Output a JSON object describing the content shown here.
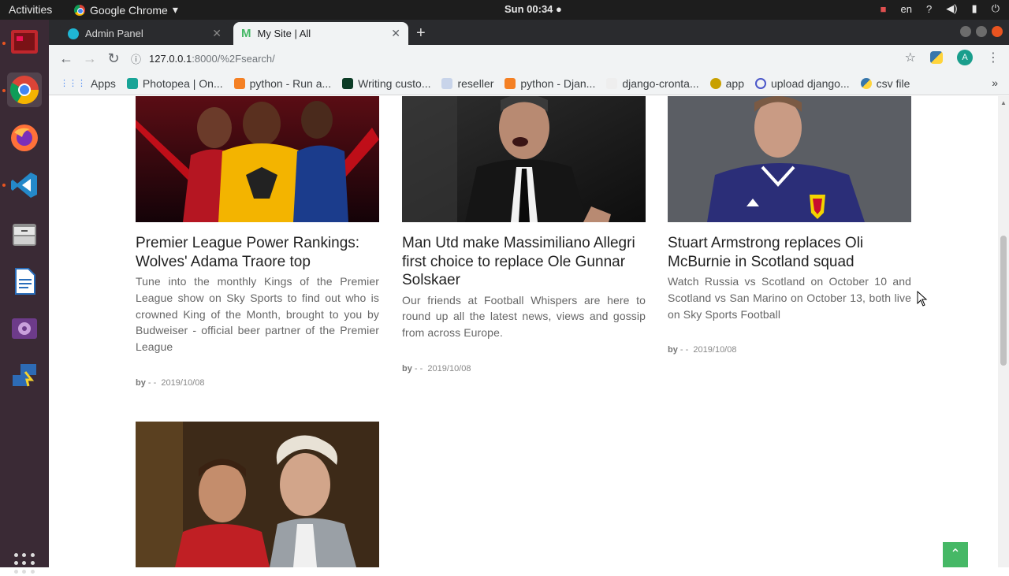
{
  "system": {
    "activities": "Activities",
    "app_name": "Google Chrome",
    "clock": "Sun 00:34 ●",
    "lang": "en"
  },
  "browser": {
    "tabs": [
      {
        "label": "Admin Panel"
      },
      {
        "label": "My Site | All"
      }
    ],
    "url_host": "127.0.0.1",
    "url_rest": ":8000/%2Fsearch/",
    "avatar_letter": "A",
    "bookmarks": [
      {
        "label": "Apps"
      },
      {
        "label": "Photopea | On..."
      },
      {
        "label": "python - Run a..."
      },
      {
        "label": "Writing custo..."
      },
      {
        "label": "reseller"
      },
      {
        "label": "python - Djan..."
      },
      {
        "label": "django-cronta..."
      },
      {
        "label": "app"
      },
      {
        "label": "upload django..."
      },
      {
        "label": "csv file"
      }
    ]
  },
  "articles": [
    {
      "title": "Premier League Power Rankings: Wolves' Adama Traore top",
      "excerpt": "Tune into the monthly Kings of the Premier League show on Sky Sports to find out who is crowned King of the Month, brought to you by Budweiser - official beer partner of the Premier League",
      "by": "by",
      "author": "- -",
      "date": "2019/10/08"
    },
    {
      "title": "Man Utd make Massimiliano Allegri first choice to replace Ole Gunnar Solskaer",
      "excerpt": "Our friends at Football Whispers are here to round up all the latest news, views and gossip from across Europe.",
      "by": "by",
      "author": "- -",
      "date": "2019/10/08"
    },
    {
      "title": "Stuart Armstrong replaces Oli McBurnie in Scotland squad",
      "excerpt": "Watch Russia vs Scotland on October 10 and Scotland vs San Marino on October 13, both live on Sky Sports Football",
      "by": "by",
      "author": "- -",
      "date": "2019/10/08"
    }
  ],
  "colors": {
    "accent": "#46b866",
    "topbar": "#1d1d1d",
    "dock": "#3a2a35"
  }
}
